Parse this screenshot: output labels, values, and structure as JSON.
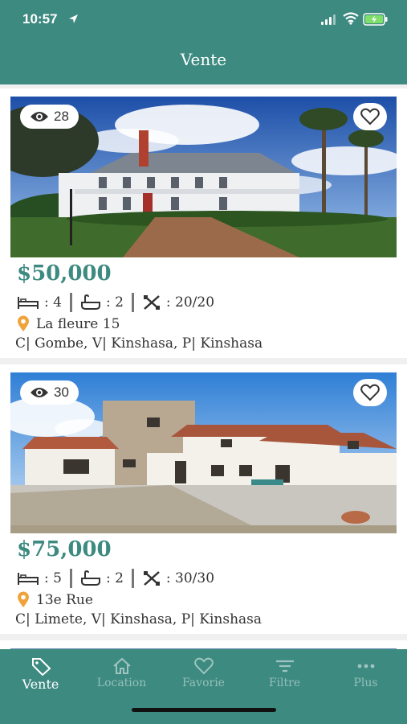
{
  "status": {
    "time": "10:57"
  },
  "header": {
    "title": "Vente"
  },
  "listings": [
    {
      "views": "28",
      "price": "$50,000",
      "beds": ": 4",
      "baths": ": 2",
      "size": ": 20/20",
      "street": "La fleure 15",
      "area": "C| Gombe, V| Kinshasa, P| Kinshasa"
    },
    {
      "views": "30",
      "price": "$75,000",
      "beds": ": 5",
      "baths": ": 2",
      "size": ": 30/30",
      "street": "13e Rue",
      "area": "C| Limete, V| Kinshasa, P| Kinshasa"
    }
  ],
  "tabs": [
    {
      "label": "Vente",
      "icon": "tag-icon"
    },
    {
      "label": "Location",
      "icon": "home-icon"
    },
    {
      "label": "Favorie",
      "icon": "heart-icon"
    },
    {
      "label": "Filtre",
      "icon": "filter-icon"
    },
    {
      "label": "Plus",
      "icon": "more-icon"
    }
  ],
  "colors": {
    "primary": "#3d8a80",
    "pin": "#f0a33a"
  }
}
